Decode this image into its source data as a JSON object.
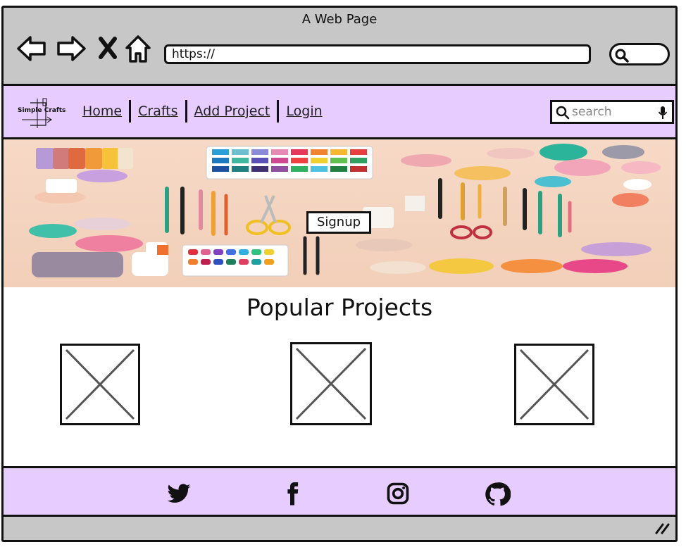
{
  "browser": {
    "title": "A Web Page",
    "url": "https://"
  },
  "site": {
    "logo_text": "Simple Crafts",
    "nav": [
      {
        "label": "Home"
      },
      {
        "label": "Crafts"
      },
      {
        "label": "Add Project"
      },
      {
        "label": "Login"
      }
    ],
    "search_placeholder": "search"
  },
  "hero": {
    "signup_label": "Signup"
  },
  "main": {
    "section_title": "Popular Projects",
    "projects_count": 3
  },
  "footer": {
    "social": [
      {
        "icon": "twitter-icon"
      },
      {
        "icon": "facebook-icon"
      },
      {
        "icon": "instagram-icon"
      },
      {
        "icon": "github-icon"
      }
    ]
  },
  "colors": {
    "chrome": "#c7c7c7",
    "header_bg": "#e6ccff",
    "footer_bg": "#e6ccff"
  }
}
